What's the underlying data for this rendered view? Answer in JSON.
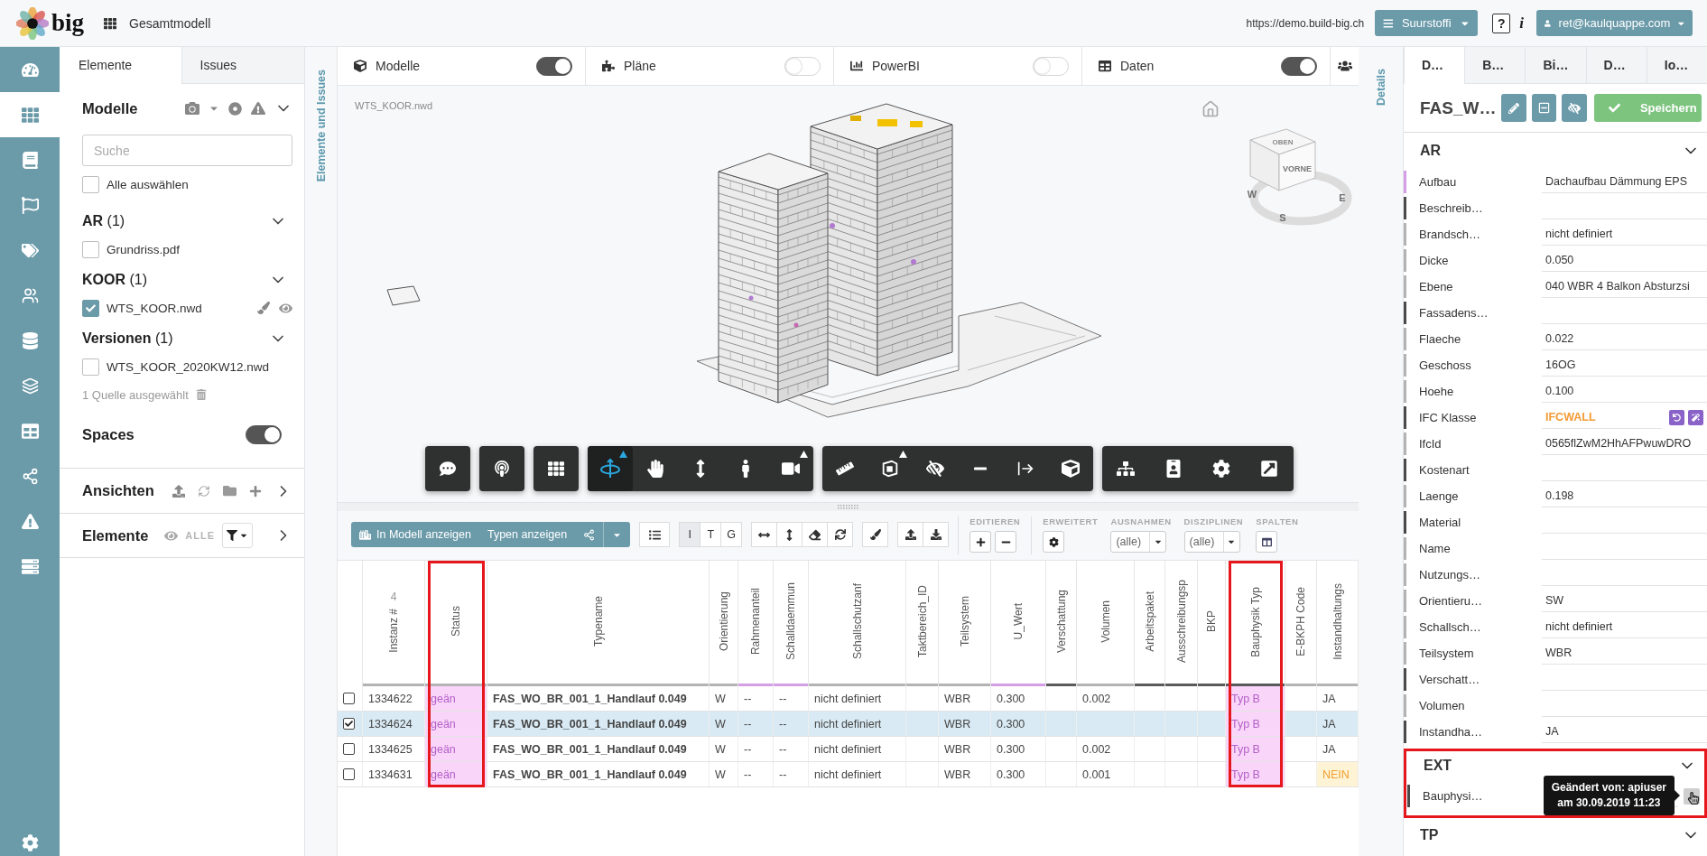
{
  "header": {
    "logo": "big",
    "project": "Gesamtmodell",
    "url": "https://demo.build-big.ch",
    "site": "Suurstoffi",
    "help": "?",
    "info": "i",
    "user": "ret@kaulquappe.com"
  },
  "nav": [
    {
      "kind": "dashboard",
      "selected": false
    },
    {
      "kind": "models",
      "selected": true
    },
    {
      "kind": "book",
      "selected": false
    },
    {
      "kind": "flag",
      "selected": false
    },
    {
      "kind": "tags",
      "selected": false
    },
    {
      "kind": "users",
      "selected": false
    },
    {
      "kind": "database",
      "selected": false
    },
    {
      "kind": "layers",
      "selected": false
    },
    {
      "kind": "table",
      "selected": false
    },
    {
      "kind": "share",
      "selected": false
    },
    {
      "kind": "warning",
      "selected": false
    },
    {
      "kind": "server",
      "selected": false
    },
    {
      "kind": "settings",
      "selected": false
    }
  ],
  "left_panel": {
    "tabs": [
      {
        "label": "Elemente",
        "selected": true
      },
      {
        "label": "Issues",
        "selected": false
      }
    ],
    "models": {
      "title": "Modelle",
      "search": {
        "placeholder": "Suche"
      },
      "select_all": {
        "label": "Alle auswählen",
        "checked": false
      },
      "groups": [
        {
          "name": "AR",
          "count": "(1)",
          "files": [
            {
              "name": "Grundriss.pdf",
              "checked": false
            }
          ]
        },
        {
          "name": "KOOR",
          "count": "(1)",
          "files": [
            {
              "name": "WTS_KOOR.nwd",
              "checked": true
            }
          ]
        },
        {
          "name": "Versionen",
          "count": "(1)",
          "files": [
            {
              "name": "WTS_KOOR_2020KW12.nwd",
              "checked": false
            }
          ]
        }
      ],
      "selection": "1 Quelle ausgewählt",
      "spaces": {
        "label": "Spaces",
        "on": true
      }
    },
    "views": {
      "title": "Ansichten"
    },
    "elements": {
      "title": "Elemente",
      "filter": "ALLE"
    }
  },
  "left_strip": {
    "label": "Elemente und Issues"
  },
  "main_toolbar": [
    {
      "kind": "models",
      "label": "Modelle",
      "on": true
    },
    {
      "kind": "plans",
      "label": "Pläne",
      "on": false
    },
    {
      "kind": "powerbi",
      "label": "PowerBI",
      "on": false
    },
    {
      "kind": "data",
      "label": "Daten",
      "on": true
    }
  ],
  "viewer": {
    "file": "WTS_KOOR.nwd",
    "view_cube": {
      "top": "OBEN",
      "front": "VORNE",
      "compass": [
        "W",
        "S",
        "E"
      ]
    },
    "tools": [
      [
        {
          "kind": "comment",
          "selected": false,
          "menu": false
        }
      ],
      [
        {
          "kind": "pin",
          "selected": false,
          "menu": false
        }
      ],
      [
        {
          "kind": "grid",
          "selected": false,
          "menu": false
        }
      ],
      [
        {
          "kind": "orbit",
          "selected": true,
          "menu": true
        },
        {
          "kind": "pan",
          "selected": false,
          "menu": false
        },
        {
          "kind": "zoom",
          "selected": false,
          "menu": false
        },
        {
          "kind": "walk",
          "selected": false,
          "menu": false
        },
        {
          "kind": "camera",
          "selected": false,
          "menu": true
        }
      ],
      [
        {
          "kind": "measure",
          "selected": false,
          "menu": false
        },
        {
          "kind": "section",
          "selected": false,
          "menu": true
        },
        {
          "kind": "hide",
          "selected": false,
          "menu": false
        },
        {
          "kind": "minus",
          "selected": false,
          "menu": false
        },
        {
          "kind": "move",
          "selected": false,
          "menu": false
        },
        {
          "kind": "explode",
          "selected": false,
          "menu": false
        }
      ],
      [
        {
          "kind": "tree",
          "selected": false,
          "menu": false
        },
        {
          "kind": "properties",
          "selected": false,
          "menu": false
        },
        {
          "kind": "settings",
          "selected": false,
          "menu": false
        },
        {
          "kind": "fullscreen",
          "selected": false,
          "menu": false
        }
      ]
    ]
  },
  "details_strip": {
    "label": "Details"
  },
  "grid_toolbar": {
    "show_in_model": "In Modell anzeigen",
    "show_types": "Typen anzeigen",
    "modes": [
      {
        "label": "I",
        "selected": true
      },
      {
        "label": "T",
        "selected": false
      },
      {
        "label": "G",
        "selected": false
      }
    ],
    "groups": [
      {
        "kind": "edit",
        "label": "EDITIEREN"
      },
      {
        "kind": "advanced",
        "label": "ERWEITERT"
      },
      {
        "kind": "select",
        "label": "AUSNAHMEN",
        "value": "(alle)"
      },
      {
        "kind": "select",
        "label": "DISZIPLINEN",
        "value": "(alle)"
      },
      {
        "kind": "columns",
        "label": "SPALTEN"
      }
    ]
  },
  "table": {
    "count": "4",
    "columns": [
      {
        "label": "Instanz #",
        "color": "#b3b3b3",
        "highlighted": false
      },
      {
        "label": "Status",
        "color": "#b3b3b3",
        "highlighted": true
      },
      {
        "label": "Typename",
        "color": "#b3b3b3",
        "highlighted": false
      },
      {
        "label": "Orientierung",
        "color": "#b3b3b3",
        "highlighted": false
      },
      {
        "label": "Rahmenanteil",
        "color": "#d49ee6",
        "highlighted": false
      },
      {
        "label": "Schalldaemmun",
        "color": "#d49ee6",
        "highlighted": false
      },
      {
        "label": "Schallschutzanf",
        "color": "#b3b3b3",
        "highlighted": false
      },
      {
        "label": "Taktbereich_ID",
        "color": "#b3b3b3",
        "highlighted": false
      },
      {
        "label": "Teilsystem",
        "color": "#b3b3b3",
        "highlighted": false
      },
      {
        "label": "U_Wert",
        "color": "#d49ee6",
        "highlighted": false
      },
      {
        "label": "Verschattung",
        "color": "#5a5a5a",
        "highlighted": false
      },
      {
        "label": "Volumen",
        "color": "#b3b3b3",
        "highlighted": false
      },
      {
        "label": "Arbeitspaket",
        "color": "#5a5a5a",
        "highlighted": false
      },
      {
        "label": "Ausschreibungsp",
        "color": "#5a5a5a",
        "highlighted": false
      },
      {
        "label": "BKP",
        "color": "#5a5a5a",
        "highlighted": false
      },
      {
        "label": "Bauphysik Typ",
        "color": "#5a5a5a",
        "highlighted": true
      },
      {
        "label": "E-BKPH Code",
        "color": "#b3b3b3",
        "highlighted": false
      },
      {
        "label": "Instandhaltungs",
        "color": "#b3b3b3",
        "highlighted": false
      }
    ],
    "rows": [
      {
        "selected": false,
        "checked": false,
        "cells": [
          "1334622",
          {
            "text": "geän",
            "kind": "changed"
          },
          "FAS_WO_BR_001_1_Handlauf 0.049",
          "W",
          "--",
          "--",
          "nicht definiert",
          null,
          "WBR",
          "0.300",
          null,
          "0.002",
          null,
          null,
          null,
          {
            "text": "Typ B",
            "kind": "changed"
          },
          null,
          "JA"
        ]
      },
      {
        "selected": true,
        "checked": true,
        "cells": [
          "1334624",
          {
            "text": "geän",
            "kind": "changed"
          },
          "FAS_WO_BR_001_1_Handlauf 0.049",
          "W",
          "--",
          "--",
          "nicht definiert",
          null,
          "WBR",
          "0.300",
          null,
          null,
          null,
          null,
          null,
          {
            "text": "Typ B",
            "kind": "changed"
          },
          null,
          "JA"
        ]
      },
      {
        "selected": false,
        "checked": false,
        "cells": [
          "1334625",
          {
            "text": "geän",
            "kind": "changed"
          },
          "FAS_WO_BR_001_1_Handlauf 0.049",
          "W",
          "--",
          "--",
          "nicht definiert",
          null,
          "WBR",
          "0.300",
          null,
          "0.002",
          null,
          null,
          null,
          {
            "text": "Typ B",
            "kind": "changed"
          },
          null,
          "JA"
        ]
      },
      {
        "selected": false,
        "checked": false,
        "cells": [
          "1334631",
          {
            "text": "geän",
            "kind": "changed"
          },
          "FAS_WO_BR_001_1_Handlauf 0.049",
          "W",
          "--",
          "--",
          "nicht definiert",
          null,
          "WBR",
          "0.300",
          null,
          "0.001",
          null,
          null,
          null,
          {
            "text": "Typ B",
            "kind": "changed"
          },
          null,
          {
            "text": "NEIN",
            "kind": "warning"
          }
        ]
      }
    ]
  },
  "right_panel": {
    "tabs": [
      {
        "label": "D…",
        "selected": true
      },
      {
        "label": "B…",
        "selected": false
      },
      {
        "label": "Bi…",
        "selected": false
      },
      {
        "label": "D…",
        "selected": false
      },
      {
        "label": "Io…",
        "selected": false
      }
    ],
    "title": "FAS_W…",
    "save": "Speichern",
    "sections": [
      {
        "title": "AR",
        "highlighted": false,
        "rows": [
          {
            "label": "Aufbau",
            "value": "Dachaufbau Dämmung EPS",
            "kind": "text",
            "color": "#d49ee6"
          },
          {
            "label": "Beschreib…",
            "kind": "text",
            "color": "#4a4a4a"
          },
          {
            "label": "Brandsch…",
            "value": "nicht definiert",
            "kind": "text",
            "color": "#b3b3b3"
          },
          {
            "label": "Dicke",
            "value": "0.050",
            "kind": "text",
            "color": "#b3b3b3"
          },
          {
            "label": "Ebene",
            "value": "040 WBR 4 Balkon Absturzsi",
            "kind": "text",
            "color": "#b3b3b3"
          },
          {
            "label": "Fassadens…",
            "kind": "text",
            "color": "#4a4a4a"
          },
          {
            "label": "Flaeche",
            "value": "0.022",
            "kind": "text",
            "color": "#b3b3b3"
          },
          {
            "label": "Geschoss",
            "value": "16OG",
            "kind": "text",
            "color": "#b3b3b3"
          },
          {
            "label": "Hoehe",
            "value": "0.100",
            "kind": "text",
            "color": "#b3b3b3"
          },
          {
            "label": "IFC Klasse",
            "value": "IFCWALL",
            "kind": "class",
            "color": "#4a4a4a"
          },
          {
            "label": "IfcId",
            "value": "0565flZwM2HhAFPwuwDRO",
            "kind": "text",
            "color": "#b3b3b3"
          },
          {
            "label": "Kostenart",
            "kind": "text",
            "color": "#4a4a4a"
          },
          {
            "label": "Laenge",
            "value": "0.198",
            "kind": "text",
            "color": "#b3b3b3"
          },
          {
            "label": "Material",
            "kind": "text",
            "color": "#4a4a4a"
          },
          {
            "label": "Name",
            "kind": "text",
            "color": "#b3b3b3"
          },
          {
            "label": "Nutzungs…",
            "kind": "text",
            "color": "#b3b3b3"
          },
          {
            "label": "Orientieru…",
            "value": "SW",
            "kind": "text",
            "color": "#b3b3b3"
          },
          {
            "label": "Schallsch…",
            "value": "nicht definiert",
            "kind": "text",
            "color": "#b3b3b3"
          },
          {
            "label": "Teilsystem",
            "value": "WBR",
            "kind": "text",
            "color": "#b3b3b3"
          },
          {
            "label": "Verschatt…",
            "kind": "text",
            "color": "#4a4a4a"
          },
          {
            "label": "Volumen",
            "kind": "text",
            "color": "#b3b3b3"
          },
          {
            "label": "Instandha…",
            "value": "JA",
            "kind": "text",
            "color": "#4a4a4a"
          }
        ]
      },
      {
        "title": "EXT",
        "highlighted": true,
        "rows": [
          {
            "label": "Bauphysi…",
            "kind": "history",
            "color": "#4a4a4a",
            "tooltip": [
              "Geändert von: apiuser",
              "am 30.09.2019 11:23"
            ]
          }
        ]
      },
      {
        "title": "TP",
        "highlighted": false
      }
    ]
  }
}
